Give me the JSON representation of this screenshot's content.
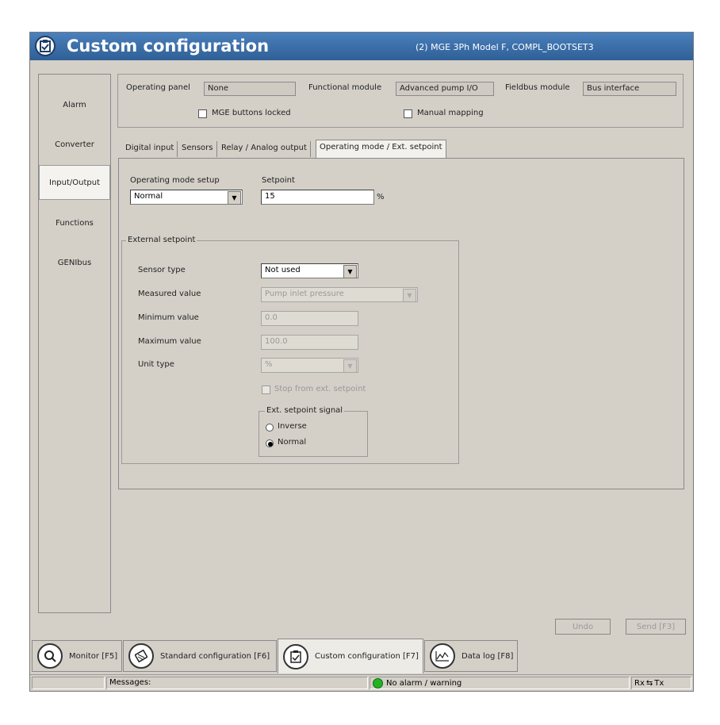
{
  "window": {
    "title": "Custom configuration",
    "subtitle": "(2) MGE 3Ph Model F, COMPL_BOOTSET3"
  },
  "sidebar": {
    "items": [
      {
        "label": "Alarm",
        "active": false
      },
      {
        "label": "Converter",
        "active": false
      },
      {
        "label": "Input/Output",
        "active": true
      },
      {
        "label": "Functions",
        "active": false
      },
      {
        "label": "GENIbus",
        "active": false
      }
    ]
  },
  "header": {
    "operating_panel_label": "Operating panel",
    "operating_panel_value": "None",
    "functional_module_label": "Functional module",
    "functional_module_value": "Advanced pump I/O",
    "fieldbus_module_label": "Fieldbus module",
    "fieldbus_module_value": "Bus interface",
    "mge_buttons_locked_label": "MGE buttons locked",
    "manual_mapping_label": "Manual mapping"
  },
  "tabs": [
    {
      "label": "Digital input",
      "active": false
    },
    {
      "label": "Sensors",
      "active": false
    },
    {
      "label": "Relay / Analog output",
      "active": false
    },
    {
      "label": "Operating mode / Ext. setpoint",
      "active": true
    }
  ],
  "panel": {
    "operating_mode_label": "Operating mode setup",
    "operating_mode_value": "Normal",
    "setpoint_label": "Setpoint",
    "setpoint_value": "15",
    "setpoint_unit": "%",
    "external_setpoint": {
      "legend": "External setpoint",
      "sensor_type_label": "Sensor type",
      "sensor_type_value": "Not used",
      "measured_value_label": "Measured value",
      "measured_value_value": "Pump inlet pressure",
      "minimum_value_label": "Minimum value",
      "minimum_value_value": "0.0",
      "maximum_value_label": "Maximum value",
      "maximum_value_value": "100.0",
      "unit_type_label": "Unit type",
      "unit_type_value": "%",
      "stop_from_ext_label": "Stop from ext. setpoint",
      "signal_legend": "Ext. setpoint signal",
      "signal_options": [
        {
          "label": "Inverse",
          "selected": false
        },
        {
          "label": "Normal",
          "selected": true
        }
      ]
    }
  },
  "actions": {
    "undo_label": "Undo",
    "send_label": "Send [F3]"
  },
  "bottom_tabs": [
    {
      "label": "Monitor [F5]",
      "icon": "magnifier-icon",
      "active": false
    },
    {
      "label": "Standard configuration [F6]",
      "icon": "settings-disk-icon",
      "active": false
    },
    {
      "label": "Custom configuration [F7]",
      "icon": "clipboard-check-icon",
      "active": true
    },
    {
      "label": "Data log [F8]",
      "icon": "chart-icon",
      "active": false
    }
  ],
  "statusbar": {
    "messages_label": "Messages:",
    "alarm_status": "No alarm / warning",
    "alarm_color": "#22b322",
    "rx_label": "Rx",
    "tx_label": "Tx"
  },
  "colors": {
    "title_bar": "#3b6ea5",
    "window_bg": "#d4d0c8"
  }
}
